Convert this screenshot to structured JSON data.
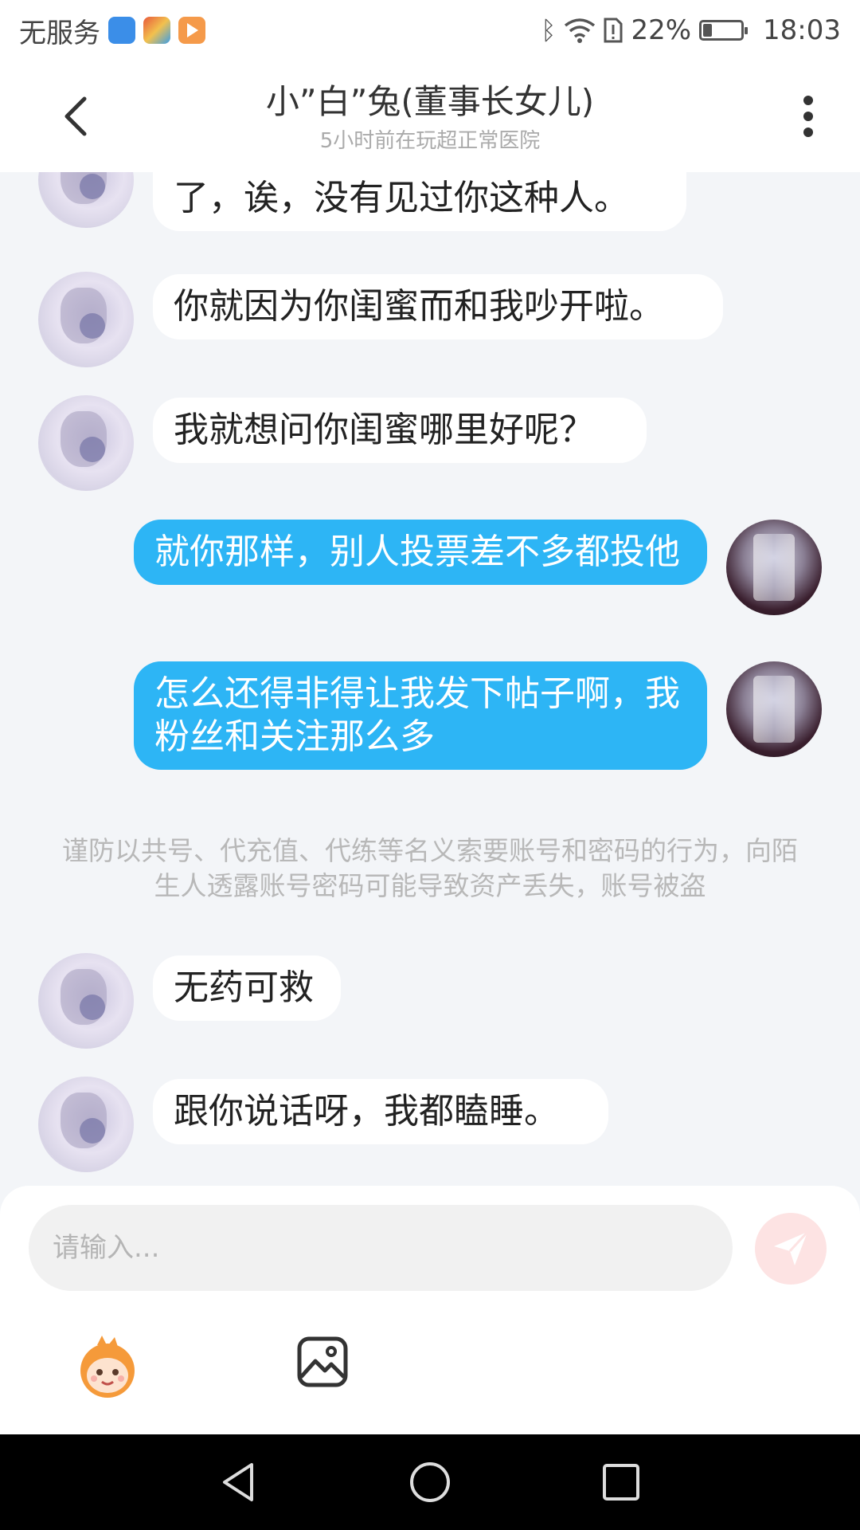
{
  "status_bar": {
    "carrier": "无服务",
    "battery_percent": "22%",
    "time": "18:03"
  },
  "header": {
    "title": "小”白”兔(董事长女儿)",
    "subtitle": "5小时前在玩超正常医院"
  },
  "messages": [
    {
      "sender": "other",
      "text": "是你无缘嘴的，还赖上我头上了，诶，没有见过你这种人。"
    },
    {
      "sender": "other",
      "text": "你就因为你闺蜜而和我吵开啦。"
    },
    {
      "sender": "other",
      "text": "我就想问你闺蜜哪里好呢？"
    },
    {
      "sender": "self",
      "text": "就你那样，别人投票差不多都投他"
    },
    {
      "sender": "self",
      "text": "怎么还得非得让我发下帖子啊，我粉丝和关注那么多"
    },
    {
      "sender": "other",
      "text": "无药可救"
    },
    {
      "sender": "other",
      "text": "跟你说话呀，我都瞌睡。"
    }
  ],
  "warning_text": "谨防以共号、代充值、代练等名义索要账号和密码的行为，向陌生人透露账号密码可能导致资产丢失，账号被盗",
  "input": {
    "placeholder": "请输入..."
  },
  "colors": {
    "self_bubble": "#2db5f5",
    "other_bubble": "#ffffff",
    "background": "#f3f5f8",
    "send_button": "#fde3e3"
  }
}
